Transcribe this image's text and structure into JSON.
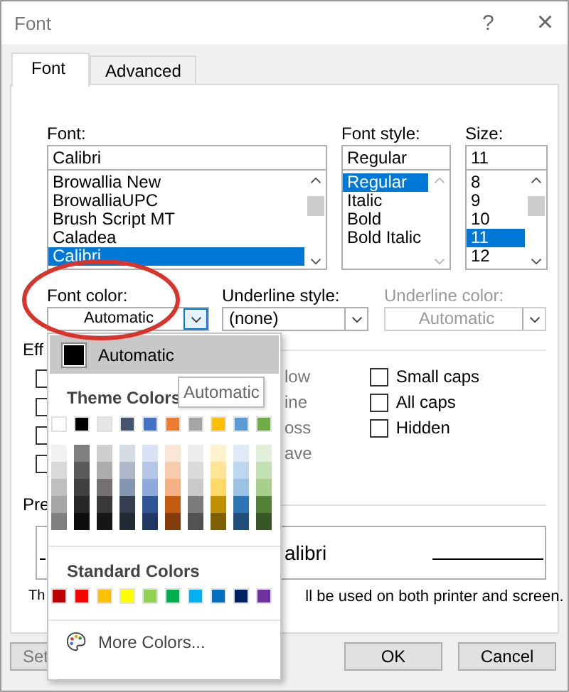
{
  "window": {
    "title": "Font",
    "help": "?",
    "close": "×"
  },
  "tabs": [
    {
      "label": "Font",
      "selected": true
    },
    {
      "label": "Advanced",
      "selected": false
    }
  ],
  "font": {
    "label": "Font:",
    "value": "Calibri",
    "items": [
      {
        "label": "Browallia New",
        "selected": false
      },
      {
        "label": "BrowalliaUPC",
        "selected": false
      },
      {
        "label": "Brush Script MT",
        "selected": false
      },
      {
        "label": "Caladea",
        "selected": false
      },
      {
        "label": "Calibri",
        "selected": true
      }
    ]
  },
  "font_style": {
    "label": "Font style:",
    "value": "Regular",
    "items": [
      {
        "label": "Regular",
        "selected": true
      },
      {
        "label": "Italic",
        "selected": false
      },
      {
        "label": "Bold",
        "selected": false
      },
      {
        "label": "Bold Italic",
        "selected": false
      }
    ]
  },
  "size": {
    "label": "Size:",
    "value": "11",
    "items": [
      {
        "label": "8",
        "selected": false
      },
      {
        "label": "9",
        "selected": false
      },
      {
        "label": "10",
        "selected": false
      },
      {
        "label": "11",
        "selected": true
      },
      {
        "label": "12",
        "selected": false
      }
    ]
  },
  "font_color": {
    "label": "Font color:",
    "value": "Automatic"
  },
  "underline_style": {
    "label": "Underline style:",
    "value": "(none)"
  },
  "underline_color": {
    "label": "Underline color:",
    "value": "Automatic",
    "disabled": true
  },
  "effects": {
    "label": "Eff",
    "left": [
      {
        "checked": false
      },
      {
        "checked": false
      },
      {
        "checked": false
      },
      {
        "checked": false
      }
    ],
    "middle_label_ends": [
      "low",
      "ine",
      "oss",
      "ave"
    ],
    "right": [
      {
        "label": "Small caps",
        "checked": false
      },
      {
        "label": "All caps",
        "checked": false
      },
      {
        "label": "Hidden",
        "checked": false
      }
    ]
  },
  "preview": {
    "label": "Pre",
    "sample": "alibri",
    "note_start": "Th",
    "note_end": "ll be used on both printer and screen."
  },
  "buttons": [
    {
      "label": "Set",
      "kind": "partial"
    },
    {
      "label": "OK",
      "kind": "normal"
    },
    {
      "label": "Cancel",
      "kind": "normal"
    }
  ],
  "color_menu": {
    "automatic": {
      "label": "Automatic",
      "color": "#000000",
      "selected": true
    },
    "tooltip": "Automatic",
    "theme_label": "Theme Colors",
    "theme_colors": [
      {
        "color": "#ffffff",
        "shades": [
          {
            "color": "#f2f2f2"
          },
          {
            "color": "#d9d9d9"
          },
          {
            "color": "#bfbfbf"
          },
          {
            "color": "#a6a6a6"
          },
          {
            "color": "#808080"
          }
        ]
      },
      {
        "color": "#000000",
        "shades": [
          {
            "color": "#7f7f7f"
          },
          {
            "color": "#595959"
          },
          {
            "color": "#404040"
          },
          {
            "color": "#262626"
          },
          {
            "color": "#0d0d0d"
          }
        ]
      },
      {
        "color": "#e7e6e6",
        "shades": [
          {
            "color": "#d0cece"
          },
          {
            "color": "#aeabab"
          },
          {
            "color": "#757171"
          },
          {
            "color": "#3a3838"
          },
          {
            "color": "#171616"
          }
        ]
      },
      {
        "color": "#44546a",
        "shades": [
          {
            "color": "#d6dce4"
          },
          {
            "color": "#adb9ca"
          },
          {
            "color": "#8497b0"
          },
          {
            "color": "#333f4f"
          },
          {
            "color": "#222a35"
          }
        ]
      },
      {
        "color": "#4472c4",
        "shades": [
          {
            "color": "#d9e2f3"
          },
          {
            "color": "#b4c6e7"
          },
          {
            "color": "#8eaadb"
          },
          {
            "color": "#2f5496"
          },
          {
            "color": "#1f3864"
          }
        ]
      },
      {
        "color": "#ed7d31",
        "shades": [
          {
            "color": "#fbe5d5"
          },
          {
            "color": "#f7cbac"
          },
          {
            "color": "#f4b183"
          },
          {
            "color": "#c55a11"
          },
          {
            "color": "#833c0b"
          }
        ]
      },
      {
        "color": "#a5a5a5",
        "shades": [
          {
            "color": "#ededed"
          },
          {
            "color": "#dbdbdb"
          },
          {
            "color": "#c9c9c9"
          },
          {
            "color": "#7b7b7b"
          },
          {
            "color": "#525252"
          }
        ]
      },
      {
        "color": "#ffc000",
        "shades": [
          {
            "color": "#fff2cc"
          },
          {
            "color": "#fee599"
          },
          {
            "color": "#ffd965"
          },
          {
            "color": "#bf9000"
          },
          {
            "color": "#7f6000"
          }
        ]
      },
      {
        "color": "#5b9bd5",
        "shades": [
          {
            "color": "#deebf6"
          },
          {
            "color": "#bdd7ee"
          },
          {
            "color": "#9cc3e5"
          },
          {
            "color": "#2e75b5"
          },
          {
            "color": "#1e4e79"
          }
        ]
      },
      {
        "color": "#70ad47",
        "shades": [
          {
            "color": "#e2efd9"
          },
          {
            "color": "#c5e0b3"
          },
          {
            "color": "#a8d08d"
          },
          {
            "color": "#538135"
          },
          {
            "color": "#375623"
          }
        ]
      }
    ],
    "standard_label": "Standard Colors",
    "standard_colors": [
      {
        "color": "#c00000"
      },
      {
        "color": "#ff0000"
      },
      {
        "color": "#ffc000"
      },
      {
        "color": "#ffff00"
      },
      {
        "color": "#92d050"
      },
      {
        "color": "#00b050"
      },
      {
        "color": "#00b0f0"
      },
      {
        "color": "#0070c0"
      },
      {
        "color": "#002060"
      },
      {
        "color": "#7030a0"
      }
    ],
    "more": "More Colors..."
  },
  "annotation": {
    "kind": "ellipse",
    "color": "#d9342b"
  }
}
